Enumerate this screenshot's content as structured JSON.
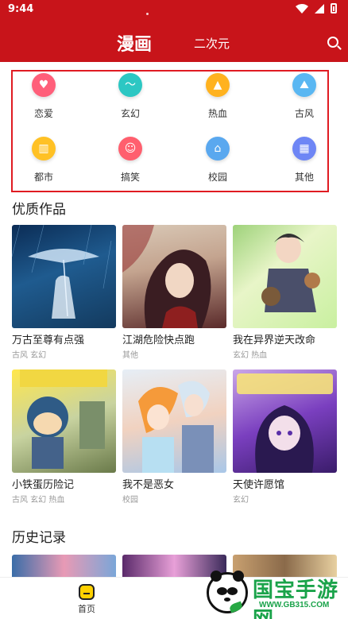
{
  "status_bar": {
    "time": "9:44"
  },
  "header": {
    "tab_active": "漫画",
    "tab_other": "二次元"
  },
  "categories": [
    {
      "label": "恋爱",
      "icon": "heart-icon",
      "color": "#ff5f7a",
      "glyph": "♥"
    },
    {
      "label": "玄幻",
      "icon": "swirl-icon",
      "color": "#2cc7c3",
      "glyph": "〜"
    },
    {
      "label": "热血",
      "icon": "flame-icon",
      "color": "#ffb21f",
      "glyph": "▲"
    },
    {
      "label": "古风",
      "icon": "mountain-icon",
      "color": "#5ab7f2",
      "glyph": "⛰"
    },
    {
      "label": "都市",
      "icon": "building-icon",
      "color": "#ffc125",
      "glyph": "▥"
    },
    {
      "label": "搞笑",
      "icon": "smile-icon",
      "color": "#ff5f6e",
      "glyph": "☺"
    },
    {
      "label": "校园",
      "icon": "school-icon",
      "color": "#5aa8ef",
      "glyph": "⌂"
    },
    {
      "label": "其他",
      "icon": "grid-icon",
      "color": "#6e86f5",
      "glyph": "▦"
    }
  ],
  "featured": {
    "title": "优质作品",
    "items": [
      {
        "title": "万古至尊有点强",
        "tags": "古风 玄幻"
      },
      {
        "title": "江湖危险快点跑",
        "tags": "其他"
      },
      {
        "title": "我在异界逆天改命",
        "tags": "玄幻 热血"
      },
      {
        "title": "小铁蛋历险记",
        "tags": "古风 玄幻 热血"
      },
      {
        "title": "我不是恶女",
        "tags": "校园"
      },
      {
        "title": "天使许愿馆",
        "tags": "玄幻"
      }
    ]
  },
  "history": {
    "title": "历史记录"
  },
  "bottom_nav": {
    "home_label": "首页"
  },
  "watermark": {
    "text": "国宝手游网",
    "url": "WWW.GB315.COM"
  }
}
